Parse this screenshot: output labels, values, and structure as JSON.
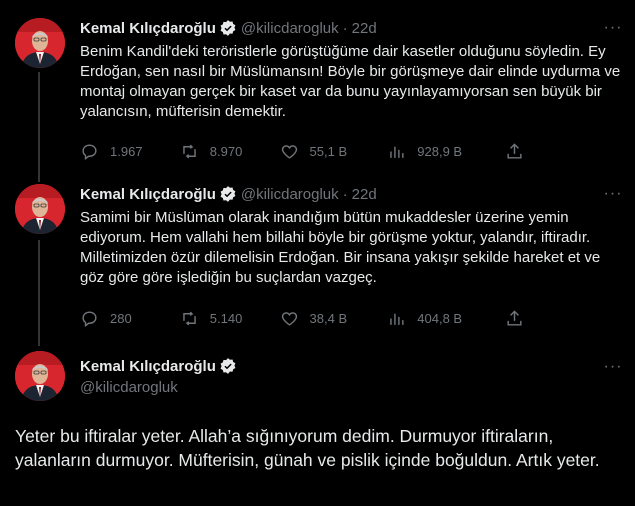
{
  "colors": {
    "background": "#000000",
    "text": "#e7e9ea",
    "muted": "#71767b",
    "verified": "#1d9bf0",
    "thread_line": "#333639"
  },
  "tweets": [
    {
      "author": "Kemal Kılıçdaroğlu",
      "handle": "@kilicdarogluk",
      "separator": "·",
      "time": "22d",
      "more": "···",
      "text": "Benim Kandil'deki teröristlerle görüştüğüme dair kasetler olduğunu söyledin. Ey Erdoğan, sen nasıl bir Müslümansın! Böyle bir görüşmeye dair elinde uydurma ve montaj olmayan gerçek bir kaset var da bunu yayınlayamıyorsan sen büyük bir yalancısın, müfterisin demektir.",
      "replies": "1.967",
      "retweets": "8.970",
      "likes": "55,1 B",
      "views": "928,9 B",
      "icons": [
        "reply-icon",
        "retweet-icon",
        "like-icon",
        "views-icon",
        "share-icon"
      ]
    },
    {
      "author": "Kemal Kılıçdaroğlu",
      "handle": "@kilicdarogluk",
      "separator": "·",
      "time": "22d",
      "more": "···",
      "text": "Samimi bir Müslüman olarak inandığım bütün mukaddesler üzerine yemin ediyorum. Hem vallahi hem billahi böyle bir görüşme yoktur, yalandır, iftiradır. Milletimizden özür dilemelisin Erdoğan. Bir insana yakışır şekilde hareket et ve göz göre göre işlediğin bu suçlardan vazgeç.",
      "replies": "280",
      "retweets": "5.140",
      "likes": "38,4 B",
      "views": "404,8 B",
      "icons": [
        "reply-icon",
        "retweet-icon",
        "like-icon",
        "views-icon",
        "share-icon"
      ]
    }
  ],
  "main_tweet": {
    "author": "Kemal Kılıçdaroğlu",
    "handle": "@kilicdarogluk",
    "more": "···",
    "text": "Yeter bu iftiralar yeter. Allah’a sığınıyorum dedim. Durmuyor iftiraların, yalanların durmuyor. Müfterisin, günah ve pislik içinde boğuldun. Artık yeter."
  }
}
